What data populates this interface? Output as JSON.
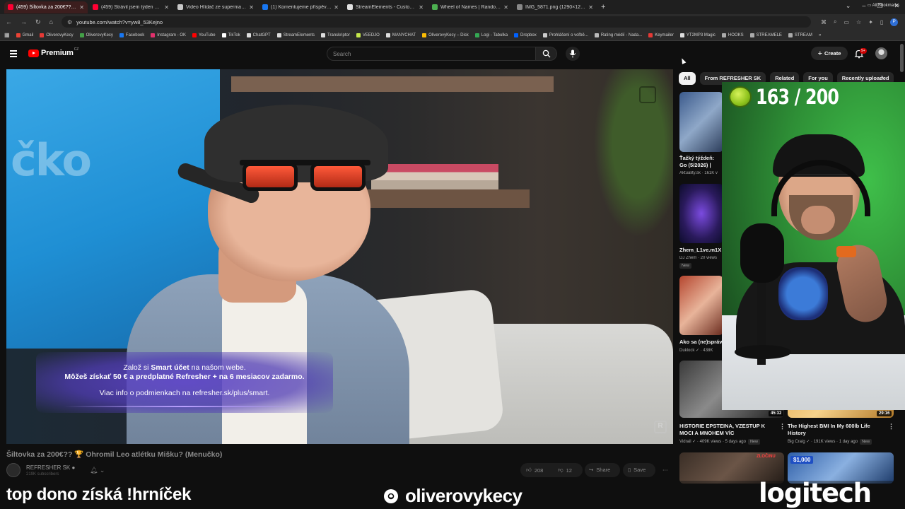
{
  "browser": {
    "tabs": [
      {
        "label": "(459) Šiltovka za 200€?? 🏆",
        "color": "#ff0033",
        "active": true
      },
      {
        "label": "(459) Strávil jsem týden na Ukr",
        "color": "#ff0033",
        "active": false
      },
      {
        "label": "Video Hlídač ze supermarketu",
        "color": "#c8c8c8",
        "active": false
      },
      {
        "label": "(1) Komentujeme příspěvky do",
        "color": "#1877f2",
        "active": false
      },
      {
        "label": "StreamElements - Custom com",
        "color": "#e0e0e0",
        "active": false
      },
      {
        "label": "Wheel of Names | Random nam",
        "color": "#4caf50",
        "active": false
      },
      {
        "label": "IMG_5871.png (1290×1253)",
        "color": "#888888",
        "active": false
      }
    ],
    "url": "youtube.com/watch?v=yw8_53Kejno",
    "bookmarks": [
      {
        "label": "Gmail",
        "color": "#ea4335"
      },
      {
        "label": "OliverovyKecy",
        "color": "#e53935"
      },
      {
        "label": "OliverovyKecy",
        "color": "#43a047"
      },
      {
        "label": "Facebook",
        "color": "#1877f2"
      },
      {
        "label": "Instagram - OK",
        "color": "#e1306c"
      },
      {
        "label": "YouTube",
        "color": "#ff0000"
      },
      {
        "label": "TikTok",
        "color": "#ffffff"
      },
      {
        "label": "ChatGPT",
        "color": "#dddddd"
      },
      {
        "label": "StreamElements",
        "color": "#dddddd"
      },
      {
        "label": "Transkriptor",
        "color": "#dddddd"
      },
      {
        "label": "VEEDJO",
        "color": "#c5e84b"
      },
      {
        "label": "MANYCHAT",
        "color": "#dddddd"
      },
      {
        "label": "OliverovyKecy – Disk",
        "color": "#fbbc04"
      },
      {
        "label": "Logi - Tabulka",
        "color": "#34a853"
      },
      {
        "label": "Dropbox",
        "color": "#0061ff"
      },
      {
        "label": "Prohlášení o voľbě...",
        "color": "#cccccc"
      },
      {
        "label": "Rating médií - Nada...",
        "color": "#bbbbbb"
      },
      {
        "label": "Keymailer",
        "color": "#e53935"
      },
      {
        "label": "YT2MP3 Magic",
        "color": "#dddddd"
      },
      {
        "label": "HOOKS",
        "color": "#aaaaaa"
      },
      {
        "label": "STREAMELE",
        "color": "#aaaaaa"
      },
      {
        "label": "STREAM",
        "color": "#aaaaaa"
      }
    ],
    "bookmarks_more": "»",
    "all_bookmarks": "All Bookmarks",
    "profile_letter": "P"
  },
  "header": {
    "logo_text": "Premium",
    "logo_region": "CZ",
    "search_placeholder": "Search",
    "create_label": "Create",
    "notification_badge": "9+"
  },
  "player": {
    "screen_text": "čko",
    "promo_line1_pre": "Založ si ",
    "promo_line1_bold": "Smart účet",
    "promo_line1_post": " na našom webe.",
    "promo_line2": "Môžeš získať 50 € a predplatné Refresher + na 6 mesiacov zadarmo.",
    "promo_line3": "Viac info o podmienkach na refresher.sk/plus/smart."
  },
  "video": {
    "title": "Šiltovka za 200€?? 🏆 Ohromil Leo atlétku Mišku? (Menučko)",
    "channel_name": "REFRESHER SK",
    "channel_subs": "219K subscribers",
    "likes": "208",
    "dislikes": "12",
    "share_label": "Share",
    "save_label": "Save"
  },
  "sidebar": {
    "chips": [
      "All",
      "From REFRESHER SK",
      "Related",
      "For you",
      "Recently uploaded"
    ],
    "recs": [
      {
        "title": "Ťažký týždeň: Go (5/2026) | Aktuali",
        "meta": "Aktuality.sk · 161K v",
        "new": false
      },
      {
        "title": "Zhem_L1ve.m1X",
        "meta": "DJ Zhem · 20 views",
        "new": true
      },
      {
        "title": "Ako sa (ne)správ",
        "meta": "Duklock ✓ · 438K",
        "new": false
      },
      {
        "title": "HISTORIE EPSTEINA, VZESTUP K MOCI A MNOHEM VÍC",
        "meta": "Vidrail ✓ · 409K views · 5 days ago",
        "new": true,
        "duration": "45:32"
      },
      {
        "title": "The Highest BMI In My 600lb Life History",
        "meta": "Big Craig ✓ · 191K views · 1 day ago",
        "new": true,
        "duration": "29:16"
      }
    ],
    "bottom_thumb_label": "$1,000",
    "bottom_thumb_tag": "ZLOČINU"
  },
  "webcam": {
    "counter": "163 / 200"
  },
  "overlay": {
    "dono_text": "top dono získá !hrníček",
    "ig_handle": "oliverovykecy",
    "sponsor": "logitech"
  }
}
